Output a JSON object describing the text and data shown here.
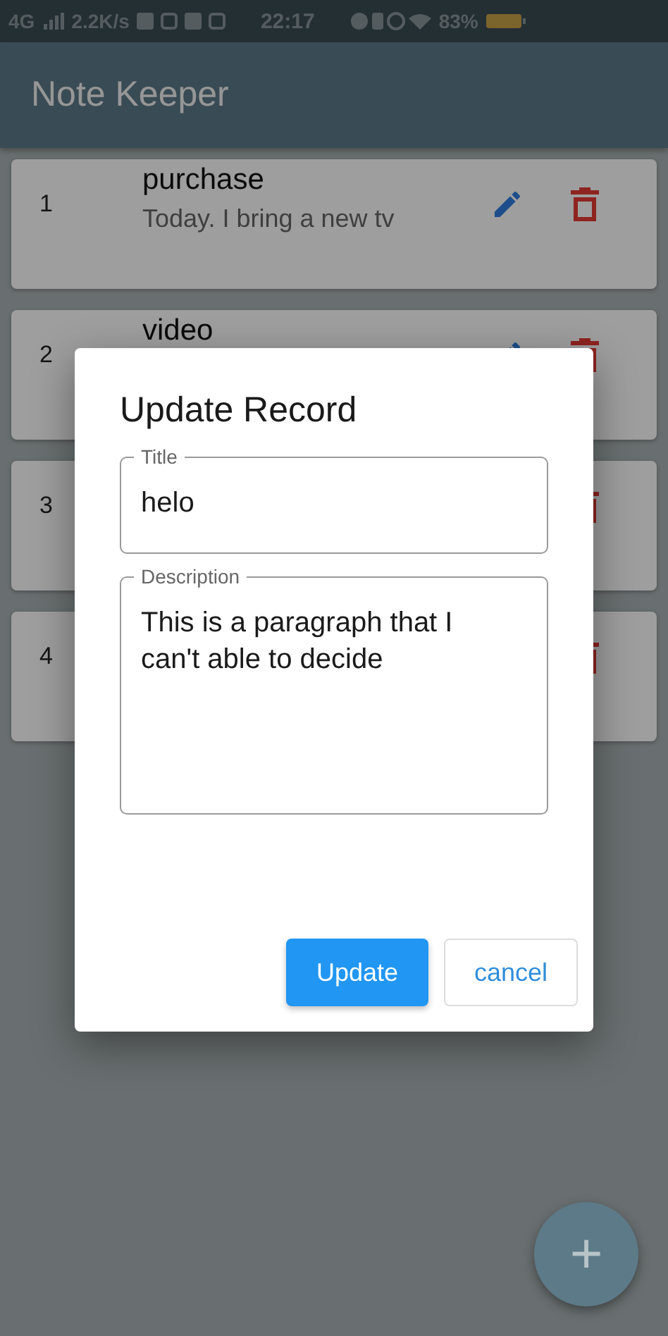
{
  "status_bar": {
    "network": "4G",
    "speed": "2.2K/s",
    "time": "22:17",
    "battery": "83%"
  },
  "app_bar": {
    "title": "Note Keeper"
  },
  "notes": [
    {
      "number": "1",
      "title": "purchase",
      "description": "Today. I bring a new tv"
    },
    {
      "number": "2",
      "title": "video"
    },
    {
      "number": "3"
    },
    {
      "number": "4"
    }
  ],
  "dialog": {
    "title": "Update Record",
    "fields": [
      {
        "kind": "line",
        "label": "Title",
        "value": "helo"
      },
      {
        "kind": "multiline",
        "label": "Description",
        "value": "This is a paragraph that I can't able to decide"
      }
    ],
    "buttons": [
      {
        "kind": "primary",
        "label": "Update"
      },
      {
        "kind": "outlined",
        "label": "cancel"
      }
    ]
  },
  "fab": {
    "label": "+"
  }
}
